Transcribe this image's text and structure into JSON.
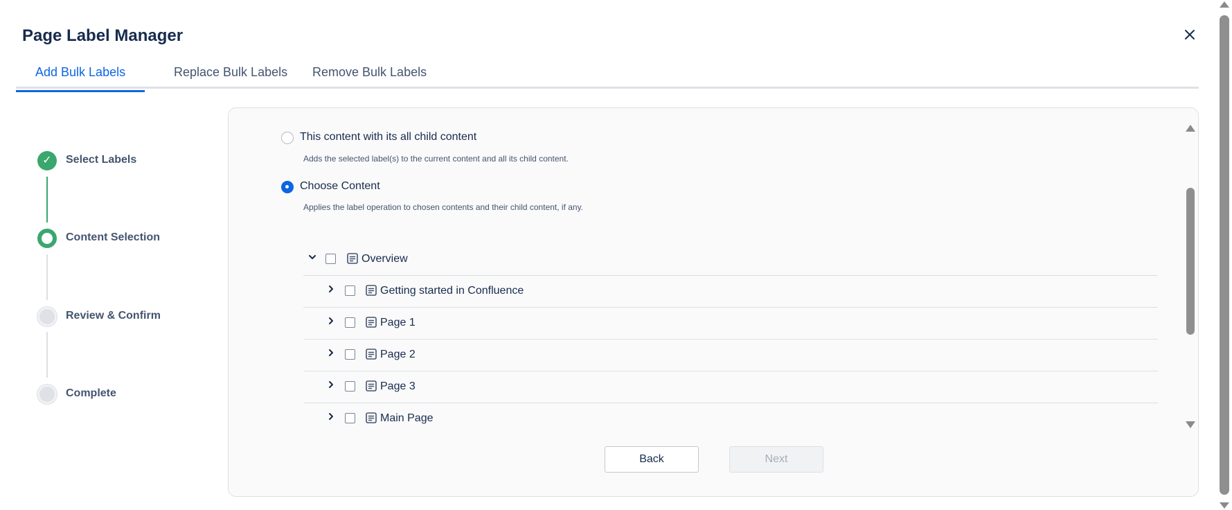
{
  "modal": {
    "title": "Page Label Manager"
  },
  "tabs": [
    {
      "label": "Add Bulk Labels",
      "active": true
    },
    {
      "label": "Replace Bulk Labels",
      "active": false
    },
    {
      "label": "Remove Bulk Labels",
      "active": false
    }
  ],
  "steps": [
    {
      "label": "Select Labels",
      "state": "done"
    },
    {
      "label": "Content Selection",
      "state": "current"
    },
    {
      "label": "Review & Confirm",
      "state": "pending"
    },
    {
      "label": "Complete",
      "state": "pending"
    }
  ],
  "options": [
    {
      "label": "This content with its all child content",
      "description": "Adds the selected label(s) to the current content and all its child content.",
      "checked": false
    },
    {
      "label": "Choose Content",
      "description": "Applies the label operation to chosen contents and their child content, if any.",
      "checked": true
    }
  ],
  "tree": {
    "root": {
      "label": "Overview",
      "expanded": true
    },
    "children": [
      {
        "label": "Getting started in Confluence"
      },
      {
        "label": "Page 1"
      },
      {
        "label": "Page 2"
      },
      {
        "label": "Page 3"
      },
      {
        "label": "Main Page"
      }
    ]
  },
  "footer": {
    "back_label": "Back",
    "next_label": "Next"
  },
  "icons": {
    "close": "close-icon",
    "check": "check-icon",
    "chevron_down": "chevron-down-icon",
    "chevron_right": "chevron-right-icon",
    "page": "page-icon"
  },
  "colors": {
    "accent": "#0c66e4",
    "success": "#3aa76d",
    "text": "#172b4d",
    "muted": "#44546f"
  }
}
